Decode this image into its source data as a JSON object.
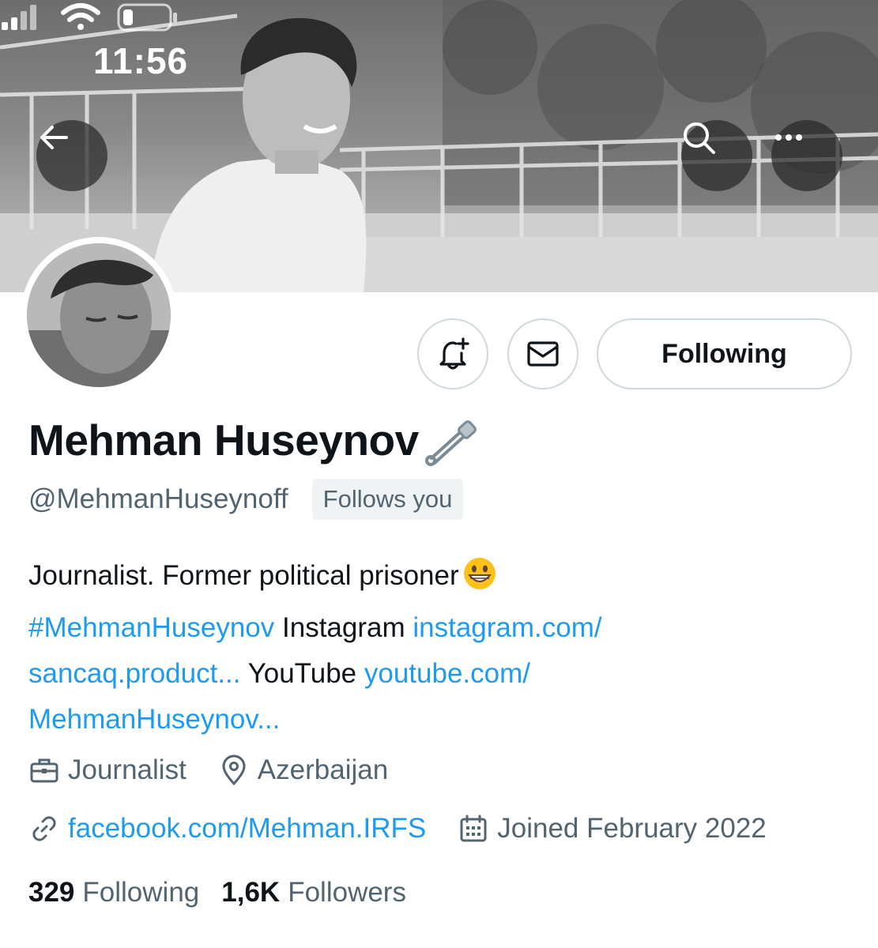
{
  "status_bar": {
    "time": "11:56",
    "signal_icon": "cellular-signal-icon",
    "wifi_icon": "wifi-icon",
    "battery_icon": "battery-icon",
    "battery_level": 0.2
  },
  "header": {
    "back_icon": "back-arrow-icon",
    "search_icon": "search-icon",
    "more_icon": "more-options-icon"
  },
  "actions": {
    "notify_icon": "bell-plus-icon",
    "message_icon": "mail-icon",
    "following_label": "Following"
  },
  "profile": {
    "name": "Mehman Huseynov",
    "name_emoji": "safety-pin-icon",
    "handle": "@MehmanHuseynoff",
    "follows_you": "Follows you",
    "bio": {
      "line1_text": "Journalist. Former political prisoner",
      "line1_emoji": "grinning-face-emoji",
      "hashtag": "#MehmanHuseynov",
      "instagram_label": " Instagram ",
      "instagram_link_1": "instagram.com/",
      "instagram_link_2": "sancaq.product...",
      "youtube_label": " YouTube ",
      "youtube_link_1": "youtube.com/",
      "youtube_link_2": "MehmanHuseynov..."
    },
    "profession": "Journalist",
    "location": "Azerbaijan",
    "website": "facebook.com/Mehman.IRFS",
    "joined": "Joined February 2022",
    "following_count": "329",
    "following_label": "Following",
    "followers_count": "1,6K",
    "followers_label": "Followers"
  },
  "colors": {
    "link": "#1d9bf0",
    "secondary_text": "#536471",
    "primary_text": "#0f1419",
    "border": "#cfd9de"
  }
}
